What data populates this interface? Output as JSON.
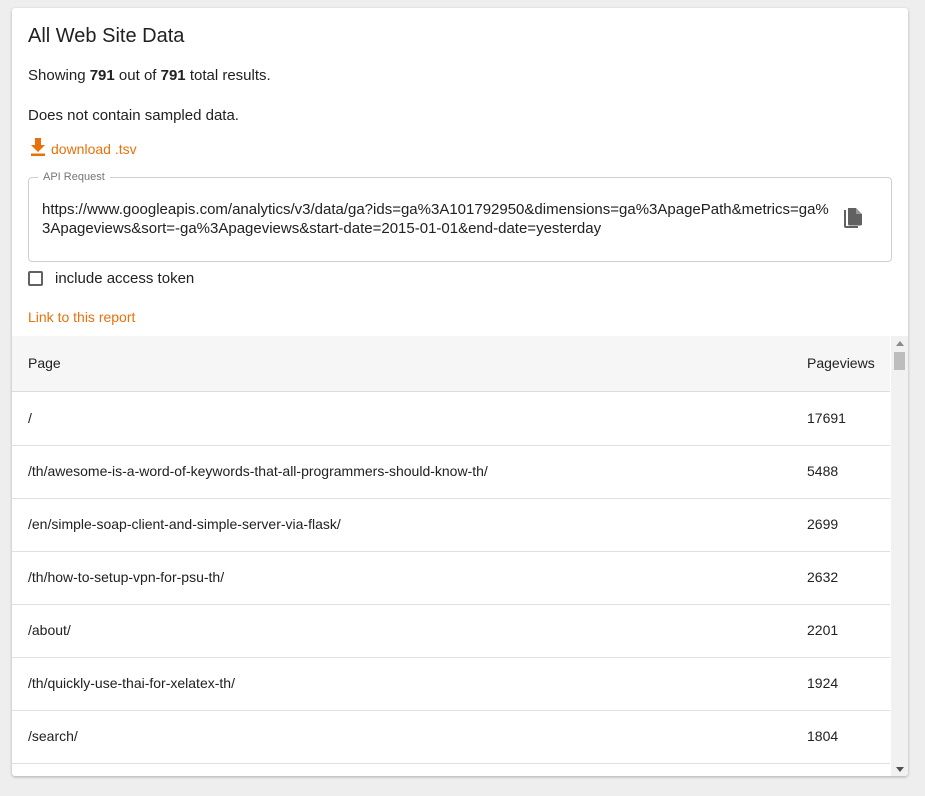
{
  "report": {
    "title": "All Web Site Data",
    "summary_prefix": "Showing",
    "shown_count": "791",
    "summary_middle": "out of",
    "total_count": "791",
    "summary_suffix": "total results.",
    "sampled_note": "Does not contain sampled data.",
    "download_label": "download .tsv",
    "link_label": "Link to this report"
  },
  "api": {
    "legend": "API Request",
    "url": "https://www.googleapis.com/analytics/v3/data/ga?ids=ga%3A101792950&dimensions=ga%3ApagePath&metrics=ga%3Apageviews&sort=-ga%3Apageviews&start-date=2015-01-01&end-date=yesterday",
    "copy_icon": "copy-icon"
  },
  "access_token": {
    "label": "include access token",
    "checked": false
  },
  "table": {
    "columns": [
      "Page",
      "Pageviews"
    ],
    "rows": [
      {
        "page": "/",
        "views": "17691"
      },
      {
        "page": "/th/awesome-is-a-word-of-keywords-that-all-programmers-should-know-th/",
        "views": "5488"
      },
      {
        "page": "/en/simple-soap-client-and-simple-server-via-flask/",
        "views": "2699"
      },
      {
        "page": "/th/how-to-setup-vpn-for-psu-th/",
        "views": "2632"
      },
      {
        "page": "/about/",
        "views": "2201"
      },
      {
        "page": "/th/quickly-use-thai-for-xelatex-th/",
        "views": "1924"
      },
      {
        "page": "/search/",
        "views": "1804"
      },
      {
        "page": "",
        "views": ""
      }
    ]
  },
  "colors": {
    "accent": "#e8710a",
    "background": "#eeeeee",
    "card": "#ffffff",
    "header_row": "#f6f6f6"
  }
}
